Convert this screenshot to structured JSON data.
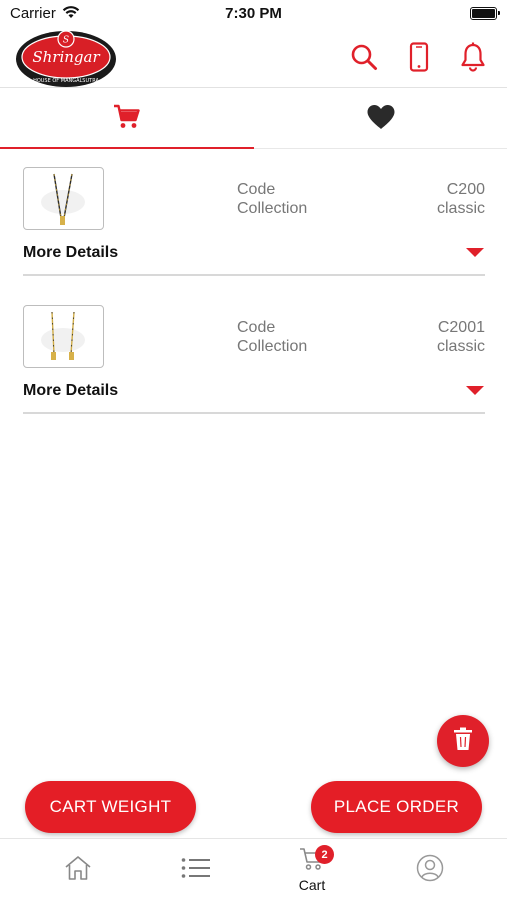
{
  "status_bar": {
    "carrier": "Carrier",
    "time": "7:30 PM"
  },
  "header": {
    "logo_text": "Shringar",
    "logo_tagline": "HOUSE OF MANGALSUTRA",
    "icons": [
      "search-icon",
      "phone-icon",
      "bell-icon"
    ]
  },
  "tabs": [
    {
      "name": "cart",
      "icon": "cart-icon",
      "active": true
    },
    {
      "name": "wishlist",
      "icon": "heart-icon",
      "active": false
    }
  ],
  "cart_items": [
    {
      "code_label": "Code",
      "code": "C200",
      "collection_label": "Collection",
      "collection": "classic",
      "more_label": "More Details"
    },
    {
      "code_label": "Code",
      "code": "C2001",
      "collection_label": "Collection",
      "collection": "classic",
      "more_label": "More Details"
    }
  ],
  "actions": {
    "cart_weight": "CART WEIGHT",
    "place_order": "PLACE ORDER"
  },
  "bottom_nav": {
    "items": [
      "home-icon",
      "list-icon",
      "cart-icon",
      "profile-icon"
    ],
    "cart_label": "Cart",
    "cart_badge": "2"
  },
  "colors": {
    "accent": "#e0202a",
    "text_muted": "#777777"
  }
}
